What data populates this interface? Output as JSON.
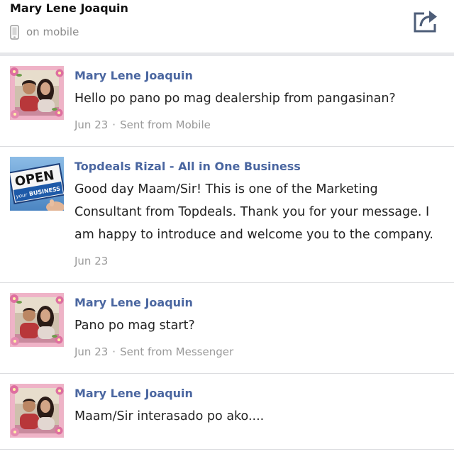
{
  "header": {
    "title": "Mary Lene Joaquin",
    "status": "on mobile",
    "status_icon": "mobile-phone-icon",
    "share_icon": "share-icon"
  },
  "colors": {
    "sender_name": "#4a66a0",
    "text": "#222222",
    "meta": "#999999",
    "divider": "#dcdde0",
    "band": "#e6e7ea",
    "icon": "#4d5d78"
  },
  "meta_separator": "·",
  "messages": [
    {
      "sender": "Mary Lene Joaquin",
      "avatar": "couple-photo-avatar",
      "text": "Hello po pano po mag dealership from pangasinan?",
      "date": "Jun 23",
      "via": "Sent from Mobile"
    },
    {
      "sender": "Topdeals Rizal - All in One Business",
      "avatar": "open-business-sign-avatar",
      "avatar_sign": {
        "line1": "OPEN",
        "line2": "your",
        "line3": "BUSINESS"
      },
      "text": "Good day Maam/Sir! This is one of the Marketing Consultant from Topdeals. Thank you for your message. I am happy to introduce and welcome you to the company.",
      "date": "Jun 23"
    },
    {
      "sender": "Mary Lene Joaquin",
      "avatar": "couple-photo-avatar",
      "text": "Pano po mag start?",
      "date": "Jun 23",
      "via": "Sent from Messenger"
    },
    {
      "sender": "Mary Lene Joaquin",
      "avatar": "couple-photo-avatar",
      "text": "Maam/Sir interasado po ako...."
    }
  ]
}
